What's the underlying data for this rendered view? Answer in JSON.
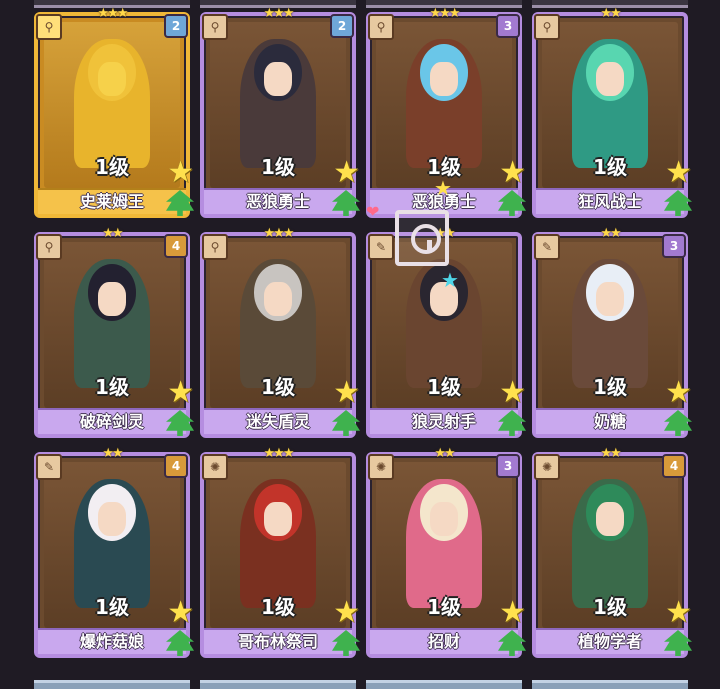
{
  "cards": [
    {
      "name": "史莱姆王",
      "level": "1级",
      "top_stars": "★★★",
      "badge": "2",
      "badge_color": "#6fa7d8",
      "gold": true,
      "hair": "#f0c23a",
      "body": "#e8b42c",
      "icon": "bone-icon"
    },
    {
      "name": "恶狼勇士",
      "level": "1级",
      "top_stars": "★★★",
      "badge": "2",
      "badge_color": "#6fa7d8",
      "gold": false,
      "hair": "#2b2b3c",
      "body": "#4a3a3a",
      "icon": "bone-icon"
    },
    {
      "name": "恶狼勇士",
      "level": "1级",
      "top_stars": "★★★",
      "badge": "3",
      "badge_color": "#a27ad0",
      "gold": false,
      "hair": "#6ac6e8",
      "body": "#7a3f2a",
      "icon": "bone-icon"
    },
    {
      "name": "狂风战士",
      "level": "1级",
      "top_stars": "★★",
      "badge": "",
      "badge_color": "",
      "gold": false,
      "hair": "#58d6b0",
      "body": "#2f9a84",
      "icon": "bone-icon"
    },
    {
      "name": "破碎剑灵",
      "level": "1级",
      "top_stars": "★★",
      "badge": "4",
      "badge_color": "#d89a3a",
      "gold": false,
      "hair": "#232130",
      "body": "#3c5a4c",
      "icon": "bone-icon"
    },
    {
      "name": "迷失盾灵",
      "level": "1级",
      "top_stars": "★★★",
      "badge": "",
      "badge_color": "",
      "gold": false,
      "hair": "#c8c4c0",
      "body": "#5a4a38",
      "icon": "bone-icon"
    },
    {
      "name": "狼灵射手",
      "level": "1级",
      "top_stars": "★★",
      "badge": "",
      "badge_color": "",
      "gold": false,
      "hair": "#2a2630",
      "body": "#6a4530",
      "icon": "feather-icon"
    },
    {
      "name": "奶糖",
      "level": "1级",
      "top_stars": "★★",
      "badge": "3",
      "badge_color": "#a27ad0",
      "gold": false,
      "hair": "#e8eef6",
      "body": "#6a4a3a",
      "icon": "feather-icon"
    },
    {
      "name": "爆炸菇娘",
      "level": "1级",
      "top_stars": "★★",
      "badge": "4",
      "badge_color": "#d89a3a",
      "gold": false,
      "hair": "#f2eef2",
      "body": "#2a4a52",
      "icon": "feather-icon"
    },
    {
      "name": "哥布林祭司",
      "level": "1级",
      "top_stars": "★★★",
      "badge": "",
      "badge_color": "",
      "gold": false,
      "hair": "#c2342a",
      "body": "#7a3020",
      "icon": "sun-icon"
    },
    {
      "name": "招财",
      "level": "1级",
      "top_stars": "★★",
      "badge": "3",
      "badge_color": "#a27ad0",
      "gold": false,
      "hair": "#f4e6cc",
      "body": "#e06a8a",
      "icon": "sun-icon"
    },
    {
      "name": "植物学者",
      "level": "1级",
      "top_stars": "★★",
      "badge": "4",
      "badge_color": "#d89a3a",
      "gold": false,
      "hair": "#2e8a5a",
      "body": "#3a6a4a",
      "icon": "sun-icon"
    }
  ]
}
